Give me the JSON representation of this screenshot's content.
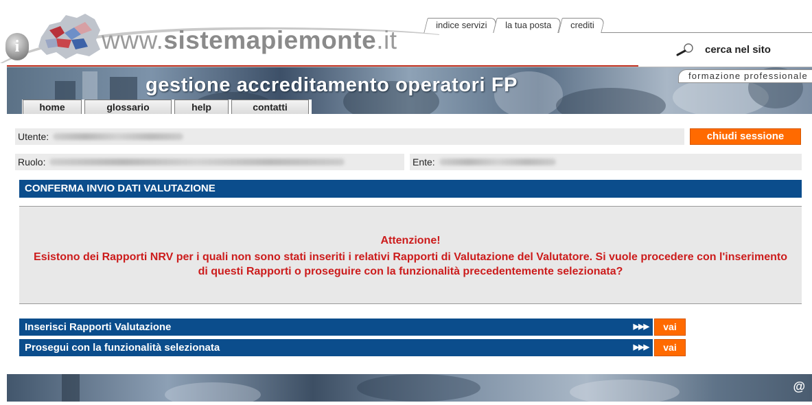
{
  "header": {
    "site_prefix": "www.",
    "site_main": "sistemapiemonte",
    "site_suffix": ".it",
    "info_glyph": "i",
    "top_tabs": [
      {
        "label": "indice servizi"
      },
      {
        "label": "la tua posta"
      },
      {
        "label": "crediti"
      }
    ],
    "search_label": "cerca nel sito"
  },
  "banner": {
    "title": "gestione accreditamento operatori FP",
    "area_tab": "formazione professionale",
    "nav": [
      {
        "label": "home"
      },
      {
        "label": "glossario"
      },
      {
        "label": "help"
      },
      {
        "label": "contatti"
      }
    ]
  },
  "session": {
    "user_label": "Utente:",
    "role_label": "Ruolo:",
    "entity_label": "Ente:",
    "close_button": "chiudi sessione"
  },
  "main": {
    "section_title": "CONFERMA INVIO DATI VALUTAZIONE",
    "warning_title": "Attenzione!",
    "warning_body": "Esistono dei Rapporti NRV per i quali non sono stati inseriti i relativi Rapporti di Valutazione del Valutatore. Si vuole procedere con l'inserimento di questi Rapporti o proseguire con la funzionalità precedentemente selezionata?",
    "actions": [
      {
        "label": "Inserisci Rapporti Valutazione",
        "arrows": "▶▶▶",
        "button": "vai"
      },
      {
        "label": "Prosegui con la funzionalità selezionata",
        "arrows": "▶▶▶",
        "button": "vai"
      }
    ]
  },
  "footer": {
    "at_glyph": "@"
  },
  "colors": {
    "section_blue": "#0b4d8c",
    "action_orange": "#ff6a00",
    "warning_red": "#cc1c1c"
  },
  "icons": [
    "info-icon",
    "piemonte-logo",
    "search-magnifier-icon",
    "arrows-icon",
    "at-icon"
  ]
}
